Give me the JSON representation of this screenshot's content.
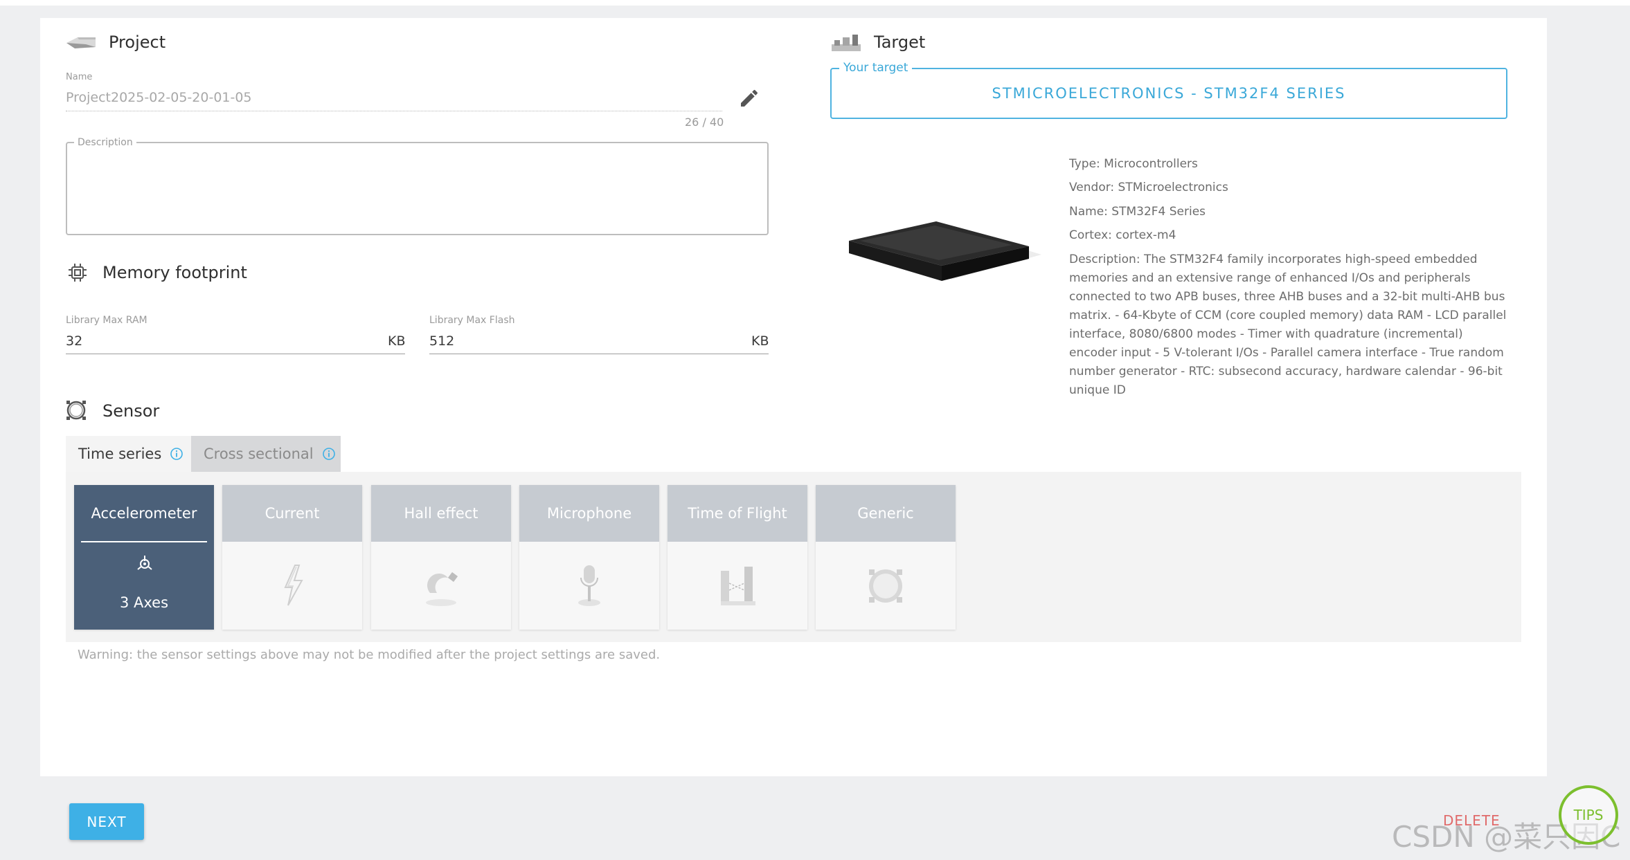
{
  "project": {
    "title": "Project",
    "name_label": "Name",
    "name_value": "Project2025-02-05-20-01-05",
    "name_counter": "26 / 40",
    "description_label": "Description",
    "description_value": ""
  },
  "memory": {
    "title": "Memory footprint",
    "ram_label": "Library Max RAM",
    "ram_value": "32",
    "ram_unit": "KB",
    "flash_label": "Library Max Flash",
    "flash_value": "512",
    "flash_unit": "KB"
  },
  "sensor": {
    "title": "Sensor",
    "tabs": [
      {
        "label": "Time series",
        "active": true
      },
      {
        "label": "Cross sectional",
        "active": false
      }
    ],
    "cards": [
      {
        "label": "Accelerometer",
        "sub": "3 Axes",
        "icon": "accelerometer-icon",
        "active": true
      },
      {
        "label": "Current",
        "icon": "lightning-icon",
        "active": false
      },
      {
        "label": "Hall effect",
        "icon": "magnet-icon",
        "active": false
      },
      {
        "label": "Microphone",
        "icon": "microphone-icon",
        "active": false
      },
      {
        "label": "Time of Flight",
        "icon": "time-of-flight-icon",
        "active": false
      },
      {
        "label": "Generic",
        "icon": "generic-sensor-icon",
        "active": false
      }
    ],
    "warning": "Warning: the sensor settings above may not be modified after the project settings are saved."
  },
  "target": {
    "title": "Target",
    "legend": "Your target",
    "name": "STMICROELECTRONICS - STM32F4 SERIES",
    "type": "Type: Microcontrollers",
    "vendor": "Vendor: STMicroelectronics",
    "chip_name": "Name: STM32F4 Series",
    "cortex": "Cortex: cortex-m4",
    "description": "Description: The STM32F4 family incorporates high-speed embedded memories and an extensive range of enhanced I/Os and peripherals connected to two APB buses, three AHB buses and a 32-bit multi-AHB bus matrix. - 64-Kbyte of CCM (core coupled memory) data RAM - LCD parallel interface, 8080/6800 modes - Timer with quadrature (incremental) encoder input - 5 V-tolerant I/Os - Parallel camera interface - True random number generator - RTC: subsecond accuracy, hardware calendar - 96-bit unique ID"
  },
  "footer": {
    "next_label": "NEXT",
    "delete_label": "DELETE",
    "tips_label": "TIPS",
    "watermark": "CSDN @菜只因C"
  },
  "colors": {
    "accent": "#3eb0e6",
    "active_card": "#4b6079",
    "inactive_card_head": "#c6cbd1",
    "tips": "#7cbf2e",
    "delete": "#e06a6a"
  }
}
